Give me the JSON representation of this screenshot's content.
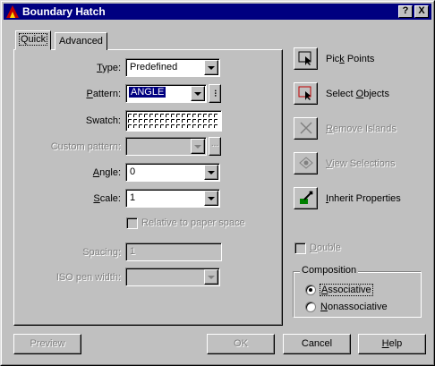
{
  "window": {
    "title": "Boundary Hatch",
    "help_glyph": "?",
    "close_glyph": "X"
  },
  "tabs": [
    {
      "label": "Quick"
    },
    {
      "label": "Advanced"
    }
  ],
  "quick": {
    "type_label": "Type:",
    "type_value": "Predefined",
    "pattern_label": "Pattern:",
    "pattern_value": "ANGLE",
    "pattern_more": "...",
    "swatch_label": "Swatch:",
    "custom_pattern_label": "Custom pattern:",
    "custom_more": "...",
    "angle_label": "Angle:",
    "angle_value": "0",
    "scale_label": "Scale:",
    "scale_value": "1",
    "relative_label": "Relative to paper space",
    "spacing_label": "Spacing:",
    "spacing_value": "1",
    "iso_label": "ISO pen width:"
  },
  "side": {
    "pick_points": "Pick Points",
    "select_objects": "Select Objects",
    "remove_islands": "Remove Islands",
    "view_selections": "View Selections",
    "inherit_properties": "Inherit Properties",
    "double": "Double",
    "composition_title": "Composition",
    "associative": "Associative",
    "nonassociative": "Nonassociative",
    "composition_selected": "Associative"
  },
  "buttons": {
    "preview": "Preview",
    "ok": "OK",
    "cancel": "Cancel",
    "help": "Help"
  },
  "colors": {
    "titlebar": "#000080",
    "face": "#c0c0c0",
    "disabled": "#808080"
  }
}
